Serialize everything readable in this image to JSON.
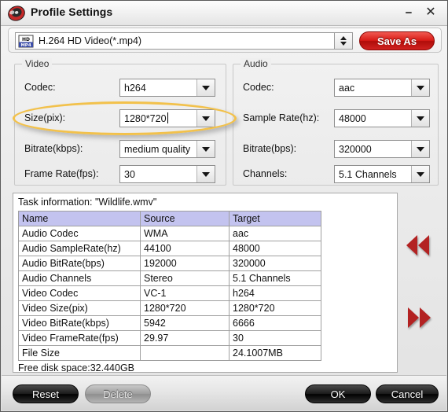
{
  "window": {
    "title": "Profile Settings",
    "app_icon": "disc-logo-icon",
    "minimize_label": "−",
    "close_label": "✕"
  },
  "format_bar": {
    "icon": "hd-mp4-file-icon",
    "icon_top_text": "HD",
    "icon_bottom_text": "MP4",
    "selected_profile": "H.264 HD Video(*.mp4)",
    "spinner": "up-down-spinner-icon",
    "save_as_label": "Save As",
    "save_as_color": "#d81b16"
  },
  "video_group": {
    "title": "Video",
    "fields": [
      {
        "label": "Codec:",
        "value": "h264"
      },
      {
        "label": "Size(pix):",
        "value": "1280*720"
      },
      {
        "label": "Bitrate(kbps):",
        "value": "medium quality"
      },
      {
        "label": "Frame Rate(fps):",
        "value": "30"
      }
    ]
  },
  "audio_group": {
    "title": "Audio",
    "fields": [
      {
        "label": "Codec:",
        "value": "aac"
      },
      {
        "label": "Sample Rate(hz):",
        "value": "48000"
      },
      {
        "label": "Bitrate(bps):",
        "value": "320000"
      },
      {
        "label": "Channels:",
        "value": "5.1 Channels"
      }
    ]
  },
  "highlight": {
    "target": "Size(pix) row",
    "color": "#f2c14b"
  },
  "task_info": {
    "caption": "Task information: \"Wildlife.wmv\"",
    "columns": [
      "Name",
      "Source",
      "Target"
    ],
    "header_bg": "#c3c3ef",
    "rows": [
      [
        "Audio Codec",
        "WMA",
        "aac"
      ],
      [
        "Audio SampleRate(hz)",
        "44100",
        "48000"
      ],
      [
        "Audio BitRate(bps)",
        "192000",
        "320000"
      ],
      [
        "Audio Channels",
        "Stereo",
        "5.1 Channels"
      ],
      [
        "Video Codec",
        "VC-1",
        "h264"
      ],
      [
        "Video Size(pix)",
        "1280*720",
        "1280*720"
      ],
      [
        "Video BitRate(kbps)",
        "5942",
        "6666"
      ],
      [
        "Video FrameRate(fps)",
        "29.97",
        "30"
      ],
      [
        "File Size",
        "",
        "24.1007MB"
      ]
    ],
    "free_disk_space": "Free disk space:32.440GB"
  },
  "nav": {
    "prev_icon": "rewind-double-arrow-icon",
    "next_icon": "fast-forward-double-arrow-icon",
    "arrow_color": "#b32222"
  },
  "buttons": {
    "reset": "Reset",
    "delete": "Delete",
    "ok": "OK",
    "cancel": "Cancel"
  }
}
